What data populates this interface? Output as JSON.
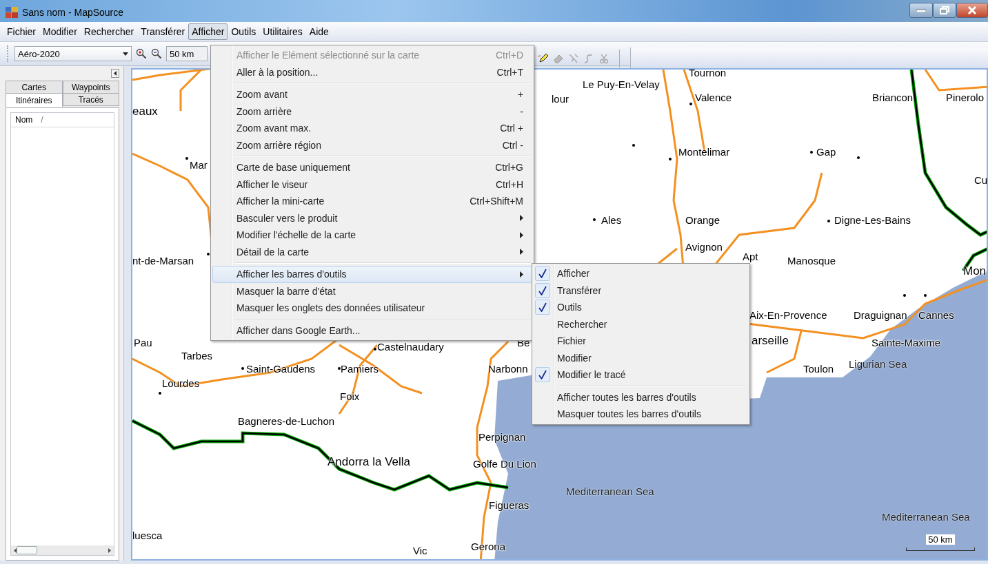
{
  "window": {
    "title": "Sans nom - MapSource"
  },
  "menu_bar": [
    {
      "label": "Fichier",
      "selected": false
    },
    {
      "label": "Modifier",
      "selected": false
    },
    {
      "label": "Rechercher",
      "selected": false
    },
    {
      "label": "Transférer",
      "selected": false
    },
    {
      "label": "Afficher",
      "selected": true
    },
    {
      "label": "Outils",
      "selected": false
    },
    {
      "label": "Utilitaires",
      "selected": false
    },
    {
      "label": "Aide",
      "selected": false
    }
  ],
  "toolbar": {
    "map_product": "Aéro-2020",
    "scale": "50 km"
  },
  "sidebar": {
    "tab_rows": [
      [
        {
          "label": "Cartes",
          "selected": false
        },
        {
          "label": "Waypoints",
          "selected": false
        }
      ],
      [
        {
          "label": "Itinéraires",
          "selected": true
        },
        {
          "label": "Tracés",
          "selected": false
        }
      ]
    ],
    "list_column": "Nom",
    "sort_mark": "/"
  },
  "menu": {
    "groups": [
      [
        {
          "label": "Afficher le Elément sélectionné sur la carte",
          "shortcut": "Ctrl+D",
          "disabled": true,
          "has_submenu": false,
          "selected": false
        },
        {
          "label": "Aller à la position...",
          "shortcut": "Ctrl+T",
          "disabled": false,
          "has_submenu": false,
          "selected": false
        }
      ],
      [
        {
          "label": "Zoom avant",
          "shortcut": "+",
          "disabled": false,
          "has_submenu": false,
          "selected": false
        },
        {
          "label": "Zoom arrière",
          "shortcut": "-",
          "disabled": false,
          "has_submenu": false,
          "selected": false
        },
        {
          "label": "Zoom avant max.",
          "shortcut": "Ctrl +",
          "disabled": false,
          "has_submenu": false,
          "selected": false
        },
        {
          "label": "Zoom arrière région",
          "shortcut": "Ctrl -",
          "disabled": false,
          "has_submenu": false,
          "selected": false
        }
      ],
      [
        {
          "label": "Carte de base uniquement",
          "shortcut": "Ctrl+G",
          "disabled": false,
          "has_submenu": false,
          "selected": false
        },
        {
          "label": "Afficher le viseur",
          "shortcut": "Ctrl+H",
          "disabled": false,
          "has_submenu": false,
          "selected": false
        },
        {
          "label": "Afficher la mini-carte",
          "shortcut": "Ctrl+Shift+M",
          "disabled": false,
          "has_submenu": false,
          "selected": false
        },
        {
          "label": "Basculer vers le produit",
          "disabled": false,
          "has_submenu": true,
          "selected": false
        },
        {
          "label": "Modifier l'échelle de la carte",
          "disabled": false,
          "has_submenu": true,
          "selected": false
        },
        {
          "label": "Détail de la carte",
          "disabled": false,
          "has_submenu": true,
          "selected": false
        }
      ],
      [
        {
          "label": "Afficher les barres d'outils",
          "disabled": false,
          "has_submenu": true,
          "selected": true
        },
        {
          "label": "Masquer la barre d'état",
          "disabled": false,
          "has_submenu": false,
          "selected": false
        },
        {
          "label": "Masquer les onglets des données utilisateur",
          "disabled": false,
          "has_submenu": false,
          "selected": false
        }
      ],
      [
        {
          "label": "Afficher dans Google Earth...",
          "disabled": false,
          "has_submenu": false,
          "selected": false
        }
      ]
    ]
  },
  "submenu": {
    "groups": [
      [
        {
          "label": "Afficher",
          "checked": true
        },
        {
          "label": "Transférer",
          "checked": true
        },
        {
          "label": "Outils",
          "checked": true
        },
        {
          "label": "Rechercher",
          "checked": false
        },
        {
          "label": "Fichier",
          "checked": false
        },
        {
          "label": "Modifier",
          "checked": false
        },
        {
          "label": "Modifier le tracé",
          "checked": true
        }
      ],
      [
        {
          "label": "Afficher toutes les barres d'outils",
          "checked": false
        },
        {
          "label": "Masquer toutes les barres d'outils",
          "checked": false
        }
      ]
    ]
  },
  "map": {
    "labels": [
      {
        "text": "eaux",
        "kind": "major"
      },
      {
        "text": "Mar",
        "kind": "city"
      },
      {
        "text": "nt-de-Marsan",
        "kind": "city"
      },
      {
        "text": "Pau",
        "kind": "city"
      },
      {
        "text": "Tarbes",
        "kind": "city"
      },
      {
        "text": "Lourdes",
        "kind": "city"
      },
      {
        "text": "Saint-Gaudens",
        "kind": "city"
      },
      {
        "text": "Pamiers",
        "kind": "city"
      },
      {
        "text": "Foix",
        "kind": "city"
      },
      {
        "text": "Castelnaudary",
        "kind": "city"
      },
      {
        "text": "Be",
        "kind": "city"
      },
      {
        "text": "Narbonn",
        "kind": "city"
      },
      {
        "text": "Bagneres-de-Luchon",
        "kind": "city"
      },
      {
        "text": "Andorra la Vella",
        "kind": "major"
      },
      {
        "text": "Perpignan",
        "kind": "city"
      },
      {
        "text": "Golfe Du Lion",
        "kind": "city"
      },
      {
        "text": "Figueras",
        "kind": "city"
      },
      {
        "text": "Gerona",
        "kind": "city"
      },
      {
        "text": "Vic",
        "kind": "city"
      },
      {
        "text": "luesca",
        "kind": "city"
      },
      {
        "text": "Mediterranean Sea",
        "kind": "sea"
      },
      {
        "text": "Mediterranean Sea",
        "kind": "sea"
      },
      {
        "text": "lour",
        "kind": "city"
      },
      {
        "text": "Le Puy-En-Velay",
        "kind": "city"
      },
      {
        "text": "Tournon",
        "kind": "city"
      },
      {
        "text": "Valence",
        "kind": "city"
      },
      {
        "text": "Briancon",
        "kind": "city"
      },
      {
        "text": "Pinerolo",
        "kind": "city"
      },
      {
        "text": "Montelimar",
        "kind": "city"
      },
      {
        "text": "Gap",
        "kind": "city"
      },
      {
        "text": "Cu",
        "kind": "city"
      },
      {
        "text": "Ales",
        "kind": "city"
      },
      {
        "text": "Orange",
        "kind": "city"
      },
      {
        "text": "Digne-Les-Bains",
        "kind": "city"
      },
      {
        "text": "Avignon",
        "kind": "city"
      },
      {
        "text": "Apt",
        "kind": "city"
      },
      {
        "text": "Manosque",
        "kind": "city"
      },
      {
        "text": "Mon",
        "kind": "major"
      },
      {
        "text": "Aix-En-Provence",
        "kind": "city"
      },
      {
        "text": "Draguignan",
        "kind": "city"
      },
      {
        "text": "Cannes",
        "kind": "city"
      },
      {
        "text": "arseille",
        "kind": "major"
      },
      {
        "text": "Sainte-Maxime",
        "kind": "city"
      },
      {
        "text": "Toulon",
        "kind": "city"
      },
      {
        "text": "Ligurian Sea",
        "kind": "sea"
      }
    ],
    "scale": "50 km"
  }
}
